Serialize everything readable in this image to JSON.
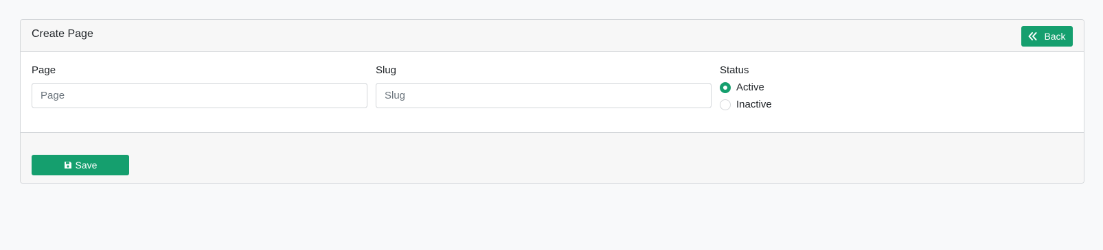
{
  "header": {
    "title": "Create Page",
    "back_label": "Back"
  },
  "form": {
    "page": {
      "label": "Page",
      "placeholder": "Page",
      "value": ""
    },
    "slug": {
      "label": "Slug",
      "placeholder": "Slug",
      "value": ""
    },
    "status": {
      "label": "Status",
      "options": [
        {
          "label": "Active",
          "checked": true
        },
        {
          "label": "Inactive",
          "checked": false
        }
      ]
    }
  },
  "footer": {
    "save_label": "Save"
  },
  "icons": {
    "back": "double-chevron-left-icon",
    "save": "floppy-disk-icon"
  },
  "colors": {
    "accent": "#159f6e",
    "page_background": "#f8f9fa",
    "header_background": "#f7f7f7",
    "border": "#d3d6d9"
  }
}
